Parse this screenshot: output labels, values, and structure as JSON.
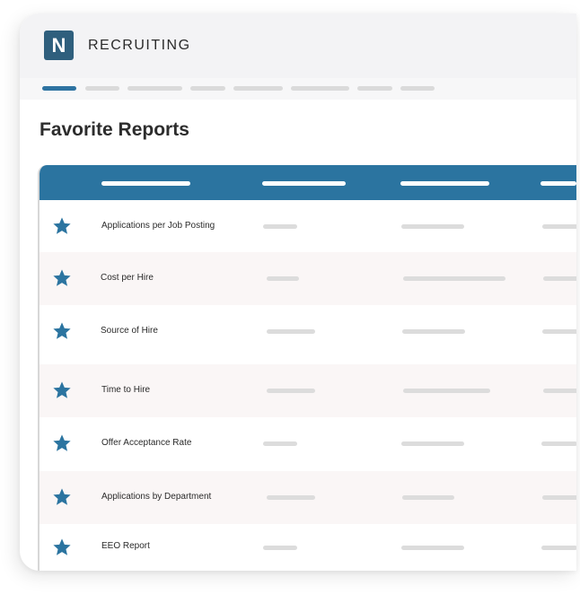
{
  "app": {
    "logo_letter": "N",
    "title": "RECRUITING"
  },
  "page": {
    "title": "Favorite Reports"
  },
  "colors": {
    "brand": "#2f5f7d",
    "accent": "#2b74a0",
    "star": "#2b74a0"
  },
  "reports": [
    {
      "label": "Applications per Job Posting",
      "favorite": true,
      "icon": "star-icon"
    },
    {
      "label": "Cost per Hire",
      "favorite": true,
      "icon": "star-icon"
    },
    {
      "label": "Source of Hire",
      "favorite": true,
      "icon": "star-icon"
    },
    {
      "label": "Time to Hire",
      "favorite": true,
      "icon": "star-icon"
    },
    {
      "label": "Offer Acceptance Rate",
      "favorite": true,
      "icon": "star-icon"
    },
    {
      "label": "Applications by Department",
      "favorite": true,
      "icon": "star-icon"
    },
    {
      "label": "EEO Report",
      "favorite": true,
      "icon": "star-icon"
    }
  ]
}
